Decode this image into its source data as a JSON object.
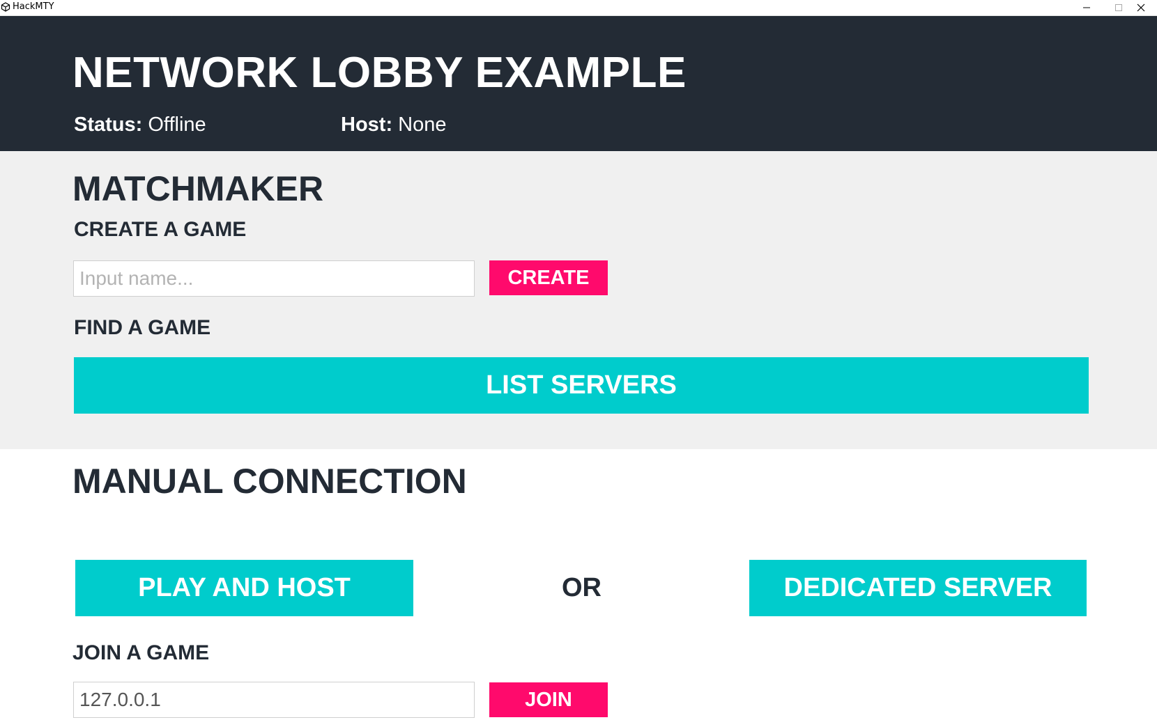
{
  "window": {
    "title": "HackMTY",
    "minimize_glyph": "–",
    "maximize_glyph": "☐",
    "close_glyph": "✕"
  },
  "header": {
    "title": "NETWORK LOBBY EXAMPLE",
    "status_label": "Status:",
    "status_value": "Offline",
    "host_label": "Host:",
    "host_value": "None"
  },
  "matchmaker": {
    "heading": "MATCHMAKER",
    "create_heading": "CREATE A GAME",
    "name_placeholder": "Input name...",
    "create_button": "CREATE",
    "find_heading": "FIND A GAME",
    "list_servers_button": "LIST SERVERS"
  },
  "manual": {
    "heading": "MANUAL CONNECTION",
    "play_host_button": "PLAY AND HOST",
    "or_text": "OR",
    "dedicated_button": "DEDICATED SERVER",
    "join_heading": "JOIN A GAME",
    "address_value": "127.0.0.1",
    "join_button": "JOIN"
  },
  "colors": {
    "header_bg": "#232b35",
    "panel_bg": "#f0f0f0",
    "accent_pink": "#ff0a6c",
    "accent_teal": "#00cccc"
  },
  "icons": {
    "app": "unity-logo-icon"
  }
}
